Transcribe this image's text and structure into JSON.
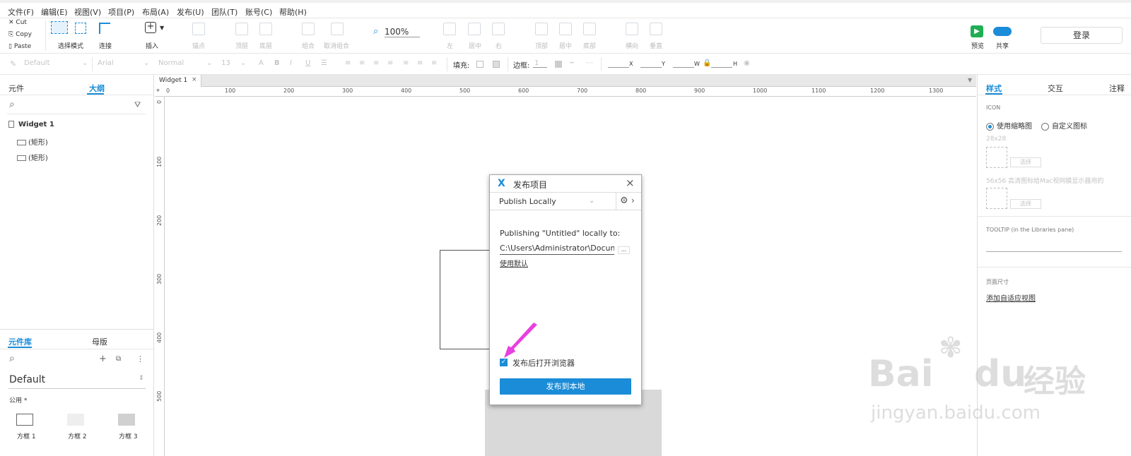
{
  "menu": [
    "文件(F)",
    "编辑(E)",
    "视图(V)",
    "项目(P)",
    "布局(A)",
    "发布(U)",
    "团队(T)",
    "账号(C)",
    "帮助(H)"
  ],
  "clipboard": {
    "cut": "Cut",
    "copy": "Copy",
    "paste": "Paste"
  },
  "toolbar": {
    "select_mode": "选择模式",
    "connect": "连接",
    "insert": "插入",
    "points": "锚点",
    "top": "顶层",
    "bottom": "底层",
    "group": "组合",
    "ungroup": "取消组合",
    "zoom": "100%",
    "left": "左",
    "center": "居中",
    "right": "右",
    "align_top": "顶部",
    "middle": "居中",
    "align_bottom": "底部",
    "h_dist": "横向",
    "v_dist": "垂直",
    "preview": "预览",
    "share": "共享",
    "login": "登录"
  },
  "format": {
    "style": "Default",
    "font": "Arial",
    "weight": "Normal",
    "size": "13",
    "fill_label": "填充:",
    "border_label": "边框:",
    "border_value": "1",
    "x_label": "X",
    "y_label": "Y",
    "w_label": "W",
    "h_label": "H"
  },
  "left": {
    "tab_widgets": "元件",
    "tab_outline": "大纲",
    "tree_root": "Widget 1",
    "tree_items": [
      "(矩形)",
      "(矩形)"
    ],
    "tab_library": "元件库",
    "tab_masters": "母版",
    "library_name": "Default",
    "category": "公用 *",
    "widgets": [
      "方框 1",
      "方框 2",
      "方框 3"
    ]
  },
  "canvas": {
    "tab": "Widget 1",
    "ruler_h": [
      "0",
      "100",
      "200",
      "300",
      "400",
      "500",
      "600",
      "700",
      "800",
      "900",
      "1000",
      "1100",
      "1200",
      "1300"
    ],
    "ruler_v": [
      "0",
      "100",
      "200",
      "300",
      "400",
      "500"
    ]
  },
  "right": {
    "tab_style": "样式",
    "tab_interact": "交互",
    "tab_notes": "注释",
    "icon_section": "ICON",
    "opt_thumbnail": "使用缩略图",
    "opt_custom": "自定义图标",
    "size_small": "28x28",
    "choose": "选择",
    "size_large": "56x56 高清图标给Mac视网膜显示器用的",
    "tooltip": "TOOLTIP (in the Libraries pane)",
    "page_size": "页面尺寸",
    "add_adaptive": "添加自适应视图"
  },
  "dialog": {
    "title": "发布项目",
    "mode": "Publish Locally",
    "publishing_text": "Publishing \"Untitled\" locally to:",
    "path": "C:\\Users\\Administrator\\Docume",
    "browse": "...",
    "use_default": "使用默认",
    "open_browser": "发布后打开浏览器",
    "publish_button": "发布到本地"
  },
  "watermark": {
    "brand": "Bai",
    "brand2": "du",
    "cn": "经验",
    "url": "jingyan.baidu.com"
  },
  "colors": {
    "accent": "#1a8cd8",
    "arrow": "#e83fe0"
  }
}
